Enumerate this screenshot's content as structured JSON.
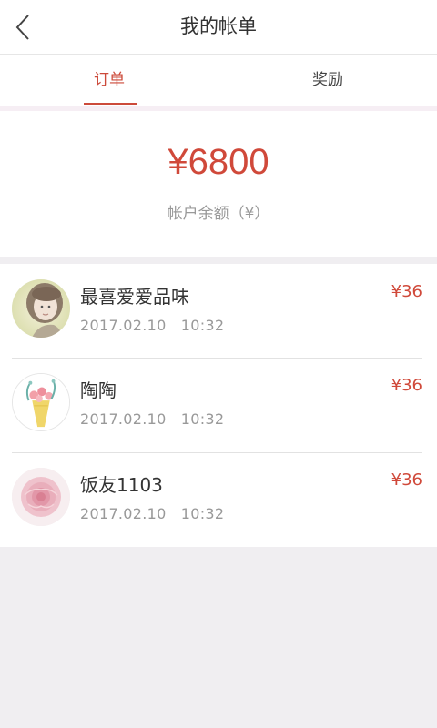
{
  "header": {
    "title": "我的帐单",
    "back_icon": "chevron-left-icon"
  },
  "tabs": [
    {
      "label": "订单",
      "active": true
    },
    {
      "label": "奖励",
      "active": false
    }
  ],
  "balance": {
    "amount": "¥6800",
    "label": "帐户余额（¥）"
  },
  "orders": [
    {
      "name": "最喜爱爱品味",
      "date": "2017.02.10",
      "time": "10:32",
      "amount": "¥36",
      "avatar": "girl-portrait-avatar"
    },
    {
      "name": "陶陶",
      "date": "2017.02.10",
      "time": "10:32",
      "amount": "¥36",
      "avatar": "flower-bouquet-avatar"
    },
    {
      "name": "饭友1103",
      "date": "2017.02.10",
      "time": "10:32",
      "amount": "¥36",
      "avatar": "pink-rose-avatar"
    }
  ],
  "colors": {
    "accent": "#cc4a3a",
    "page_background": "#f0eef1"
  }
}
